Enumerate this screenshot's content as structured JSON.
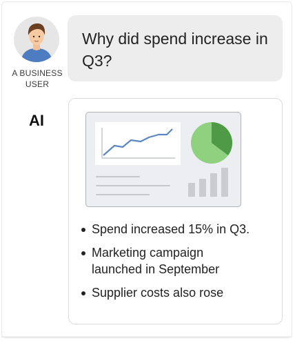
{
  "user": {
    "label": "A BUSINESS USER",
    "question": "Why did spend increase in Q3?"
  },
  "ai": {
    "label": "AI",
    "dashboard_icon": "dashboard-illustration",
    "bullets": [
      "Spend increased 15% in Q3.",
      "Marketing campaign launched in September",
      "Supplier costs also rose"
    ]
  },
  "colors": {
    "bubble": "#ededed",
    "line_series": "#5a87c4",
    "pie_light": "#8fd17f",
    "pie_dark": "#4e9a46",
    "avatar_shirt": "#4d7cc0"
  }
}
